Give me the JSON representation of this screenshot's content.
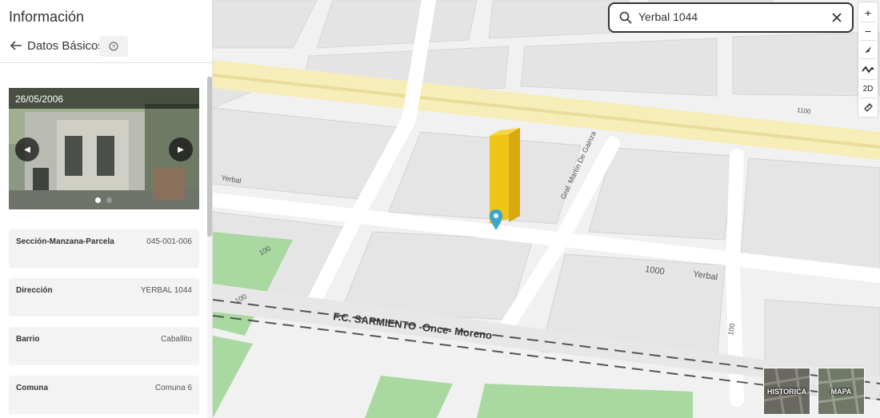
{
  "panel": {
    "title": "Información",
    "section": "Datos Básicos"
  },
  "photo": {
    "date": "26/05/2006",
    "slide_count": 2,
    "active_slide": 1
  },
  "fields": [
    {
      "label": "Sección-Manzana-Parcela",
      "value": "045-001-006"
    },
    {
      "label": "Dirección",
      "value": "YERBAL 1044"
    },
    {
      "label": "Barrio",
      "value": "Caballito"
    },
    {
      "label": "Comuna",
      "value": "Comuna 6"
    }
  ],
  "search": {
    "value": "Yerbal 1044"
  },
  "controls": {
    "zoom_in": "+",
    "zoom_out": "−",
    "view_2d": "2D"
  },
  "basemaps": {
    "historica": "HISTORICA",
    "mapa": "MAPA"
  },
  "map_labels": {
    "street_yerbal": "Yerbal",
    "street_yerbal_number": "1000",
    "street_gavina": "Gral. Martín De Gainza",
    "street_yerbal_left": "Yerbal",
    "rail": "F.C. SARMIENTO -Once- Moreno",
    "num_100_a": "100",
    "num_100_b": "100",
    "num_100_c": "100",
    "num_1100": "1100"
  },
  "colors": {
    "building": "#f0c419",
    "marker": "#3aa6c8",
    "avenue": "#f5eab2",
    "park": "#a8d8a0",
    "road": "#ffffff",
    "block": "#e6e6e6"
  }
}
